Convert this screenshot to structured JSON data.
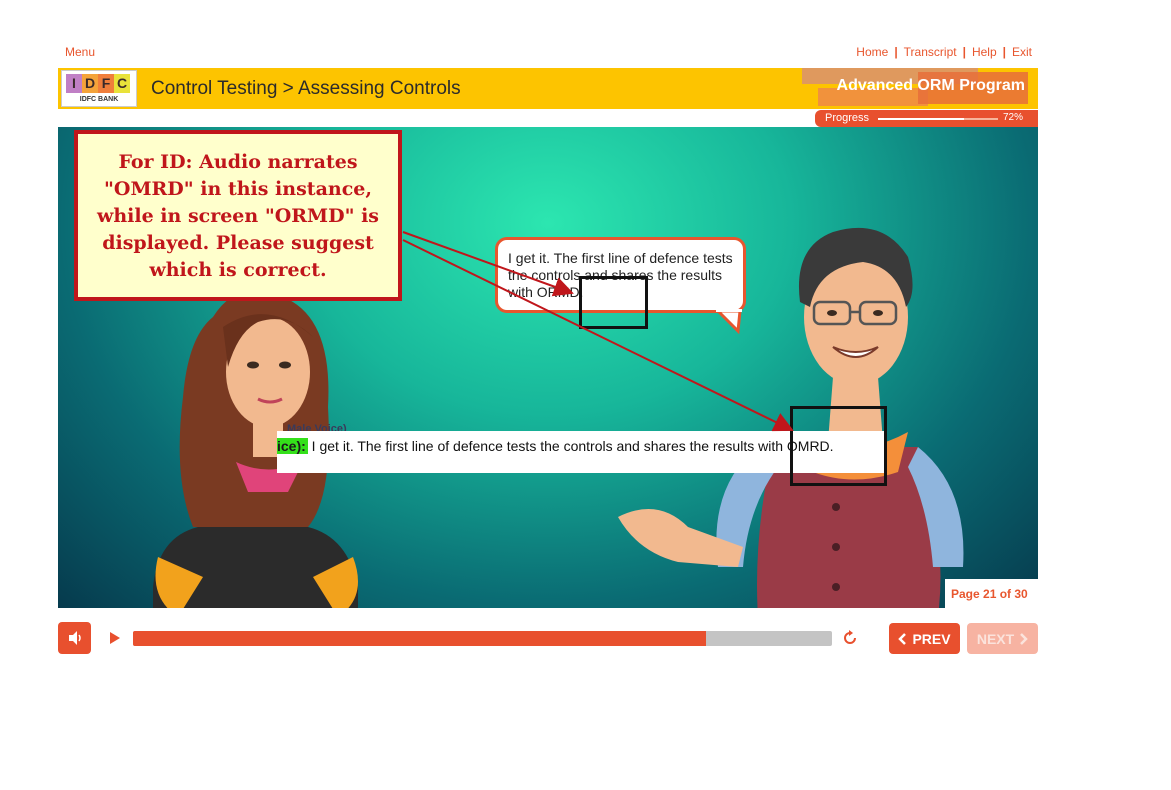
{
  "nav": {
    "menu": "Menu",
    "links": [
      "Home",
      "Transcript",
      "Help",
      "Exit"
    ]
  },
  "header": {
    "logo_letters": [
      "I",
      "D",
      "F",
      "C"
    ],
    "logo_sub": "IDFC BANK",
    "breadcrumb": "Control Testing > Assessing Controls",
    "program_title": "Advanced ORM Program"
  },
  "progress": {
    "label": "Progress",
    "percent_text": "72%",
    "value": 0.72
  },
  "note": {
    "text": "For ID: Audio narrates \"OMRD\" in this instance, while in screen \"ORMD\" is displayed. Please suggest which is correct."
  },
  "bubble": {
    "text": "I get it. The first line of defence tests the controls and shares the results with ORMD."
  },
  "transcript": {
    "speaker_fragment": "ice):",
    "line": " I get it. The first line of defence tests the controls and shares the results with OMRD.",
    "above_fragment": "Male Voice)"
  },
  "page": {
    "indicator": "Page 21 of 30"
  },
  "controls": {
    "prev": "PREV",
    "next": "NEXT",
    "audio_position": 0.82
  },
  "colors": {
    "accent": "#e8502e",
    "header_yellow": "#fdc400",
    "note_red": "#c0161b",
    "note_bg": "#ffffcc"
  }
}
